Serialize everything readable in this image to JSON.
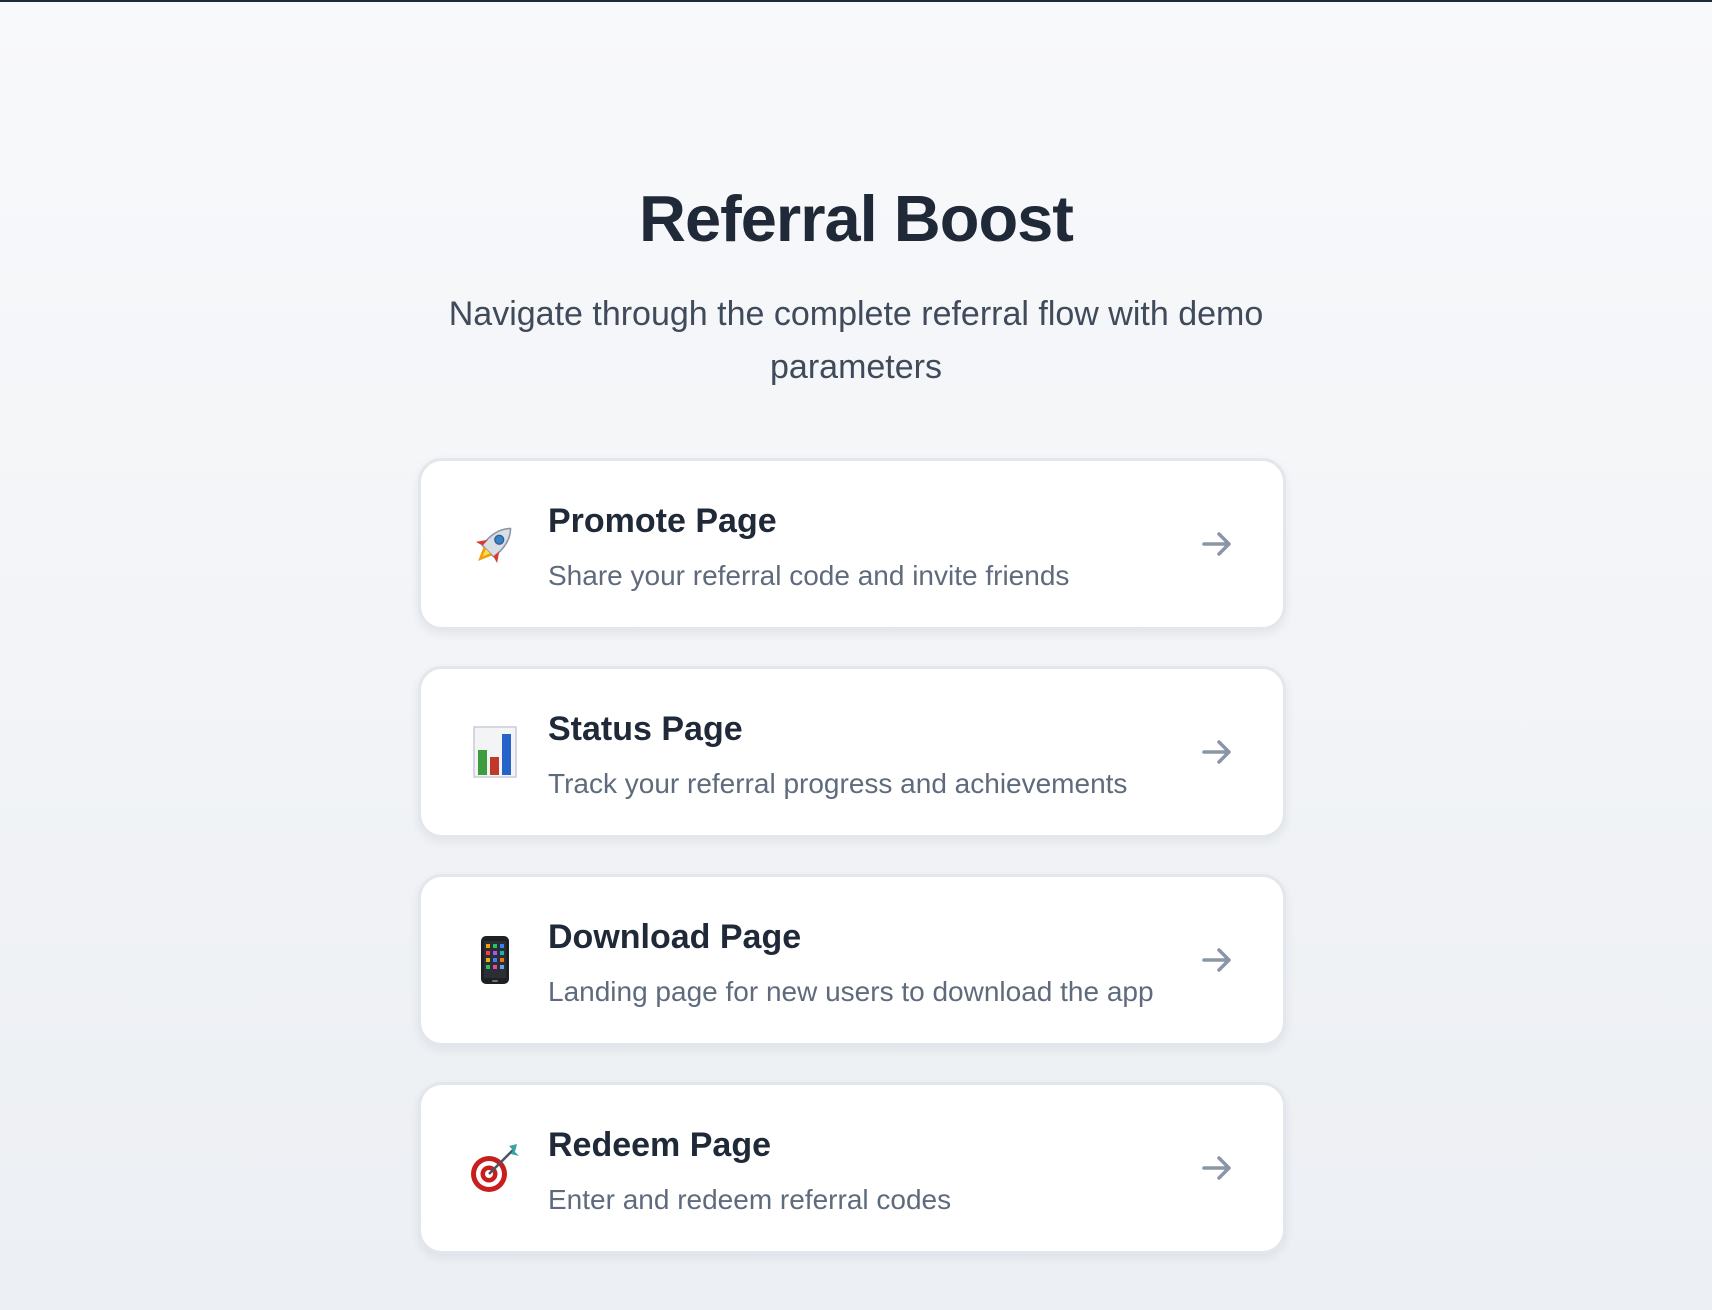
{
  "header": {
    "title": "Referral Boost",
    "subtitle": "Navigate through the complete referral flow with demo parameters"
  },
  "nav_cards": [
    {
      "icon": "rocket-icon",
      "title": "Promote Page",
      "description": "Share your referral code and invite friends"
    },
    {
      "icon": "bar-chart-icon",
      "title": "Status Page",
      "description": "Track your referral progress and achievements"
    },
    {
      "icon": "mobile-phone-icon",
      "title": "Download Page",
      "description": "Landing page for new users to download the app"
    },
    {
      "icon": "target-icon",
      "title": "Redeem Page",
      "description": "Enter and redeem referral codes"
    }
  ],
  "colors": {
    "heading": "#1f2937",
    "subtitle": "#3f4a5a",
    "description": "#5f6b7c",
    "arrow": "#8a96a8",
    "card_border": "#e3e7ed"
  }
}
